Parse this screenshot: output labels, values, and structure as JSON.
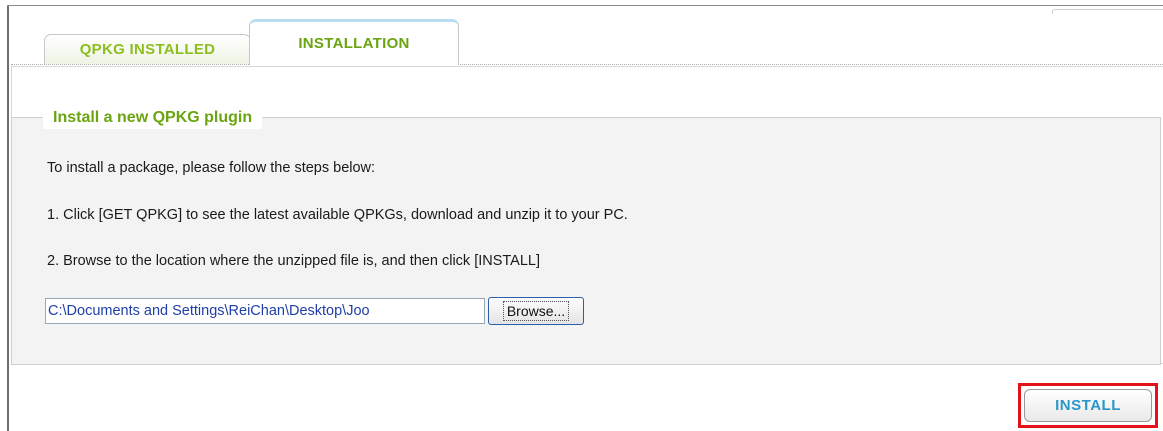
{
  "tabs": [
    {
      "label": "QPKG INSTALLED",
      "active": false
    },
    {
      "label": "INSTALLATION",
      "active": true
    }
  ],
  "section": {
    "legend": "Install a new QPKG plugin",
    "intro": "To install a package, please follow the steps below:",
    "step1": "1. Click [GET QPKG] to see the latest available QPKGs, download and unzip it to your PC.",
    "step2": "2. Browse to the location where the unzipped file is, and then click [INSTALL]"
  },
  "file_input": {
    "value": "C:\\Documents and Settings\\ReiChan\\Desktop\\Joo",
    "browse_label": "Browse..."
  },
  "actions": {
    "install_label": "INSTALL"
  },
  "colors": {
    "tab_text": "#6aa511",
    "install_text": "#2a97c9",
    "highlight": "#e3121b"
  }
}
